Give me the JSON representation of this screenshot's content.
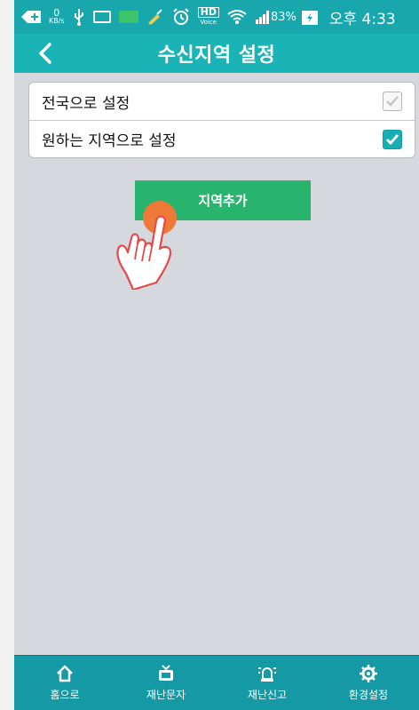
{
  "status_bar": {
    "kbs_value": "0",
    "kbs_unit": "KB/s",
    "hd_label": "HD",
    "voice_label": "Voice",
    "battery_percent": "83%",
    "time": "오후 4:33"
  },
  "header": {
    "title": "수신지역 설정"
  },
  "settings": [
    {
      "label": "전국으로 설정",
      "checked": false
    },
    {
      "label": "원하는 지역으로 설정",
      "checked": true
    }
  ],
  "add_region_button": "지역추가",
  "bottom_nav": [
    {
      "label": "홈으로",
      "icon": "home-icon"
    },
    {
      "label": "재난문자",
      "icon": "tv-icon"
    },
    {
      "label": "재난신고",
      "icon": "alarm-light-icon"
    },
    {
      "label": "환경설정",
      "icon": "gear-icon"
    }
  ],
  "colors": {
    "accent": "#1ab4b7",
    "button": "#28b46d",
    "nav": "#1499a5",
    "background": "#d5d8dd"
  }
}
